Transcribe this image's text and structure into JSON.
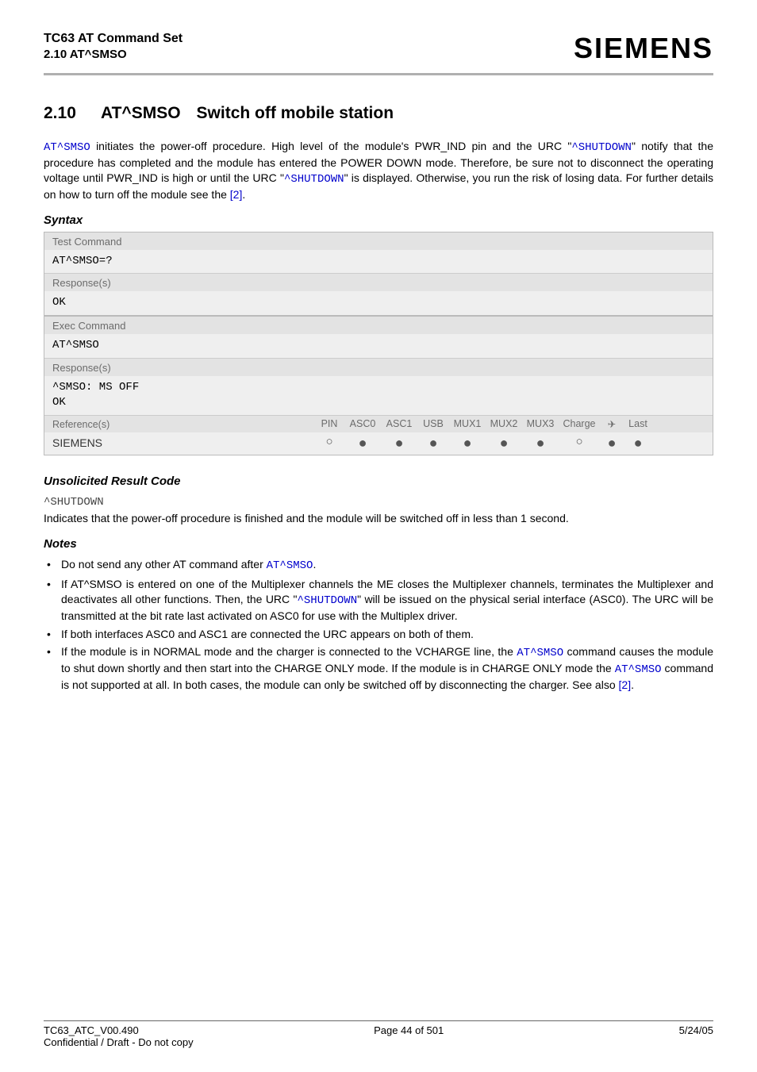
{
  "header": {
    "doc_title": "TC63 AT Command Set",
    "doc_sub": "2.10 AT^SMSO",
    "logo": "SIEMENS"
  },
  "section": {
    "num": "2.10",
    "cmd": "AT^SMSO",
    "title": "Switch off mobile station"
  },
  "intro": {
    "p1a": " initiates the power-off procedure. High level of the module's PWR_IND pin and the URC \"",
    "p1b": "\" notify that the procedure has completed and the module has entered the POWER DOWN mode. Therefore, be sure not to disconnect the operating voltage until PWR_IND is high or until the URC \"",
    "p1c": "\" is displayed. Otherwise, you run the risk of losing data. For further details on how to turn off the module see the ",
    "link_cmd": "AT^SMSO",
    "link_shutdown": "^SHUTDOWN",
    "ref2": "[2]",
    "p1d": "."
  },
  "syntax": {
    "label": "Syntax",
    "test_head": "Test Command",
    "test_cmd": "AT^SMSO=?",
    "resp_head": "Response(s)",
    "ok": "OK",
    "exec_head": "Exec Command",
    "exec_cmd": "AT^SMSO",
    "exec_resp_line1": "^SMSO: MS OFF",
    "ref_head": "Reference(s)",
    "ref_cols": [
      "PIN",
      "ASC0",
      "ASC1",
      "USB",
      "MUX1",
      "MUX2",
      "MUX3",
      "Charge",
      "✈",
      "Last"
    ],
    "siemens": "SIEMENS",
    "dots": [
      "○",
      "●",
      "●",
      "●",
      "●",
      "●",
      "●",
      "○",
      "●",
      "●"
    ]
  },
  "urc": {
    "label": "Unsolicited Result Code",
    "code": "^SHUTDOWN",
    "desc": "Indicates that the power-off procedure is finished and the module will be switched off in less than 1 second."
  },
  "notes": {
    "label": "Notes",
    "n1a": "Do not send any other AT command after ",
    "n1b": ".",
    "n2a": "If AT^SMSO is entered on one of the Multiplexer channels the ME closes the Multiplexer channels, terminates the Multiplexer and deactivates all other functions. Then, the URC \"",
    "n2b": "\" will be issued on the physical serial interface (ASC0). The URC will be transmitted at the bit rate last activated on ASC0 for use with the Multiplex driver.",
    "n3": "If both interfaces ASC0 and ASC1 are connected the URC appears on both of them.",
    "n4a": "If the module is in NORMAL mode and the charger is connected to the VCHARGE line, the ",
    "n4b": " command causes the module to shut down shortly and then start into the CHARGE ONLY mode. If the module is in CHARGE ONLY mode the ",
    "n4c": " command is not supported at all. In both cases, the module can only be switched off by disconnecting the charger. See also ",
    "n4d": "."
  },
  "footer": {
    "left": "TC63_ATC_V00.490",
    "center": "Page 44 of 501",
    "right": "5/24/05",
    "sub": "Confidential / Draft - Do not copy"
  }
}
